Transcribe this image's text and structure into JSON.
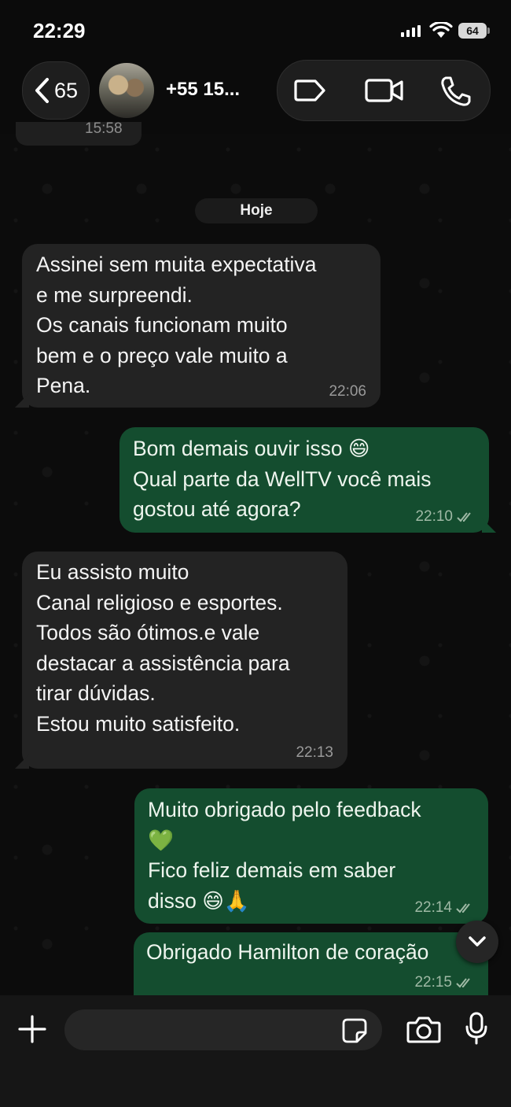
{
  "status_bar": {
    "time": "22:29",
    "battery": "64"
  },
  "header": {
    "back_count": "65",
    "contact_name": "+55 15..."
  },
  "chat": {
    "previous_time": "15:58",
    "date_label": "Hoje",
    "messages": [
      {
        "direction": "in",
        "text": "Assinei sem muita expectativa\ne me surpreendi.\nOs canais funcionam muito\nbem e o preço vale muito a\nPena.",
        "time": "22:06"
      },
      {
        "direction": "out",
        "text": "Bom demais ouvir isso 😄\nQual parte da WellTV você mais\ngostou até agora?",
        "time": "22:10",
        "status": "read"
      },
      {
        "direction": "in",
        "text": "Eu assisto muito\nCanal religioso e esportes.\nTodos são ótimos.e vale\ndestacar a assistência para\ntirar dúvidas.\nEstou muito satisfeito.",
        "time": "22:13"
      },
      {
        "direction": "out",
        "text": "Muito obrigado pelo feedback\n💚\nFico feliz demais em saber\ndisso 😄🙏",
        "time": "22:14",
        "status": "read"
      },
      {
        "direction": "out",
        "text": "Obrigado Hamilton de coração",
        "time": "22:15",
        "status": "read"
      }
    ]
  },
  "composer": {
    "placeholder": ""
  },
  "icons": {
    "back": "chevron-left-icon",
    "label": "label-tag-icon",
    "video": "video-camera-icon",
    "phone": "phone-icon",
    "scroll": "chevron-down-icon",
    "plus": "plus-icon",
    "sticker": "sticker-icon",
    "camera": "camera-icon",
    "mic": "microphone-icon",
    "read": "double-check-icon"
  },
  "colors": {
    "incoming_bubble": "#232323",
    "outgoing_bubble": "#144d2f",
    "background": "#0b0b0b"
  }
}
